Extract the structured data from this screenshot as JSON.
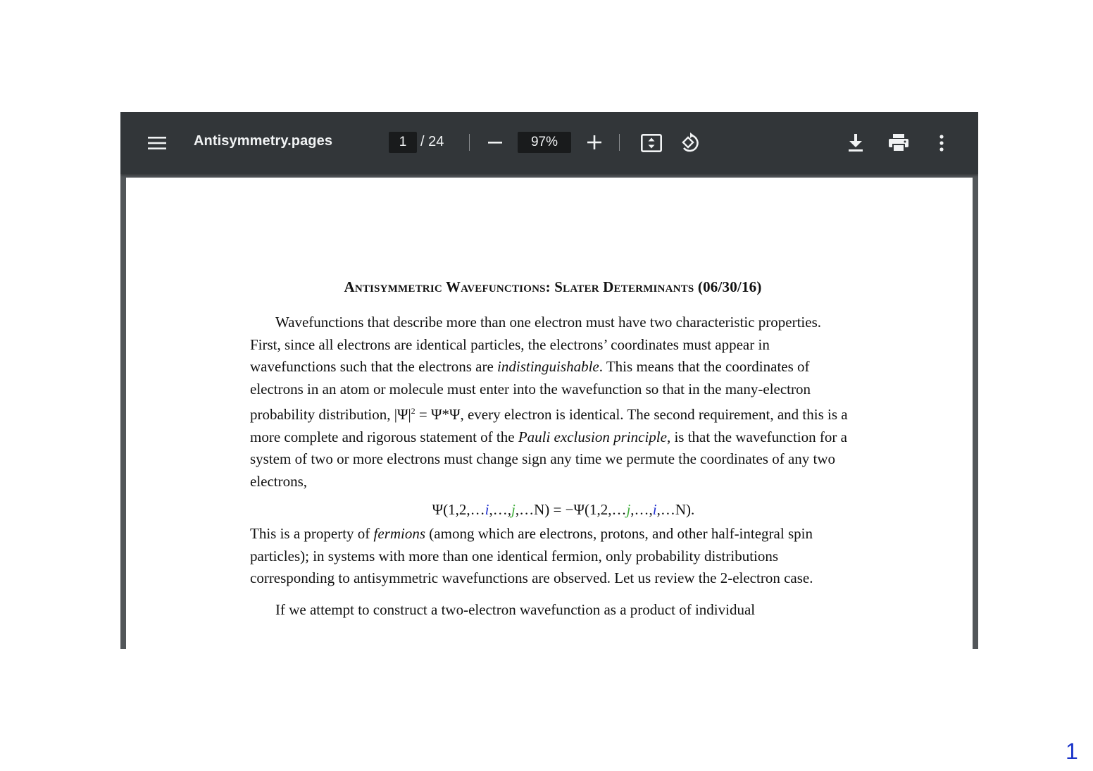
{
  "toolbar": {
    "title": "Antisymmetry.pages",
    "page_current": "1",
    "page_total": "/ 24",
    "zoom": "97%",
    "icons": [
      "menu-icon",
      "minus-icon",
      "plus-icon",
      "fit-to-page-icon",
      "rotate-icon",
      "download-icon",
      "print-icon",
      "more-vertical-icon"
    ]
  },
  "document": {
    "heading": "Antisymmetric Wavefunctions: Slater Determinants (06/30/16)",
    "p1": [
      "Wavefunctions that describe more than one electron must have two characteristic properties.  First, since all electrons are identical particles, the electrons’ coordinates must appear in wavefunctions such that the electrons are ",
      "indistinguishable",
      ".  This means that the coordinates of electrons in an atom or molecule must enter into the wavefunction so that in the many-electron probability distribution, |Ψ|",
      "2",
      " = Ψ*Ψ, every electron is identical.  The second requirement, and this is a more complete and rigorous statement of the ",
      "Pauli exclusion principle",
      ", is that the wavefunction for a system of two or more electrons must change sign any time we permute the coordinates of any two electrons,"
    ],
    "equation": [
      "Ψ(1,2,…",
      "i",
      ",…,",
      "j",
      ",…N) = −Ψ(1,2,…",
      "j",
      ",…,",
      "i",
      ",…N)."
    ],
    "p2": [
      "This is a property of ",
      "fermions",
      " (among which are electrons, protons, and other half-integral spin particles); in systems with more than one identical fermion, only probability distributions corresponding to antisymmetric wavefunctions are observed.  Let us review the 2-electron case."
    ],
    "p3": "If we attempt to construct a two-electron wavefunction as a product of individual"
  },
  "page_number": "1",
  "colors": {
    "toolbar_bg": "#323639",
    "viewer_bg": "#525659",
    "eq_i": "#1f2fd0",
    "eq_j": "#3fae3a",
    "page_number": "#1a33c9"
  }
}
